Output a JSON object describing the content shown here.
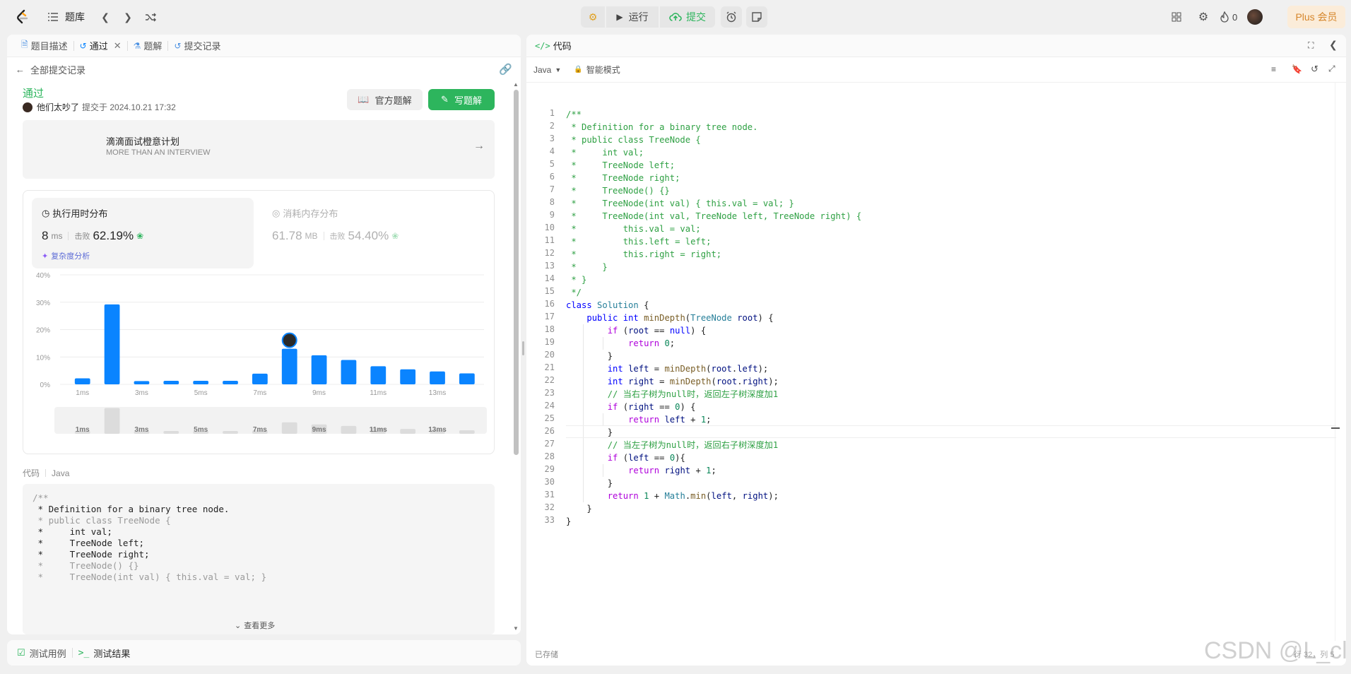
{
  "topbar": {
    "problem_list_label": "题库",
    "run_label": "运行",
    "submit_label": "提交",
    "streak_count": "0",
    "plus_label": "Plus 会员"
  },
  "left": {
    "tabs": [
      {
        "label": "题目描述"
      },
      {
        "label": "通过"
      },
      {
        "label": "题解"
      },
      {
        "label": "提交记录"
      }
    ],
    "back_label": "全部提交记录",
    "status": "通过",
    "user": "他们太吵了",
    "submitted_at": "提交于 2024.10.21 17:32",
    "official_solution_label": "官方题解",
    "write_solution_label": "写题解",
    "promo": {
      "title": "滴滴面试橙意计划",
      "subtitle": "MORE THAN AN INTERVIEW"
    },
    "runtime": {
      "title": "执行用时分布",
      "value": "8",
      "unit": "ms",
      "beats_label": "击败",
      "beats": "62.19%",
      "analysis_label": "复杂度分析"
    },
    "memory": {
      "title": "消耗内存分布",
      "value": "61.78",
      "unit": "MB",
      "beats_label": "击败",
      "beats": "54.40%"
    },
    "code_label": "代码",
    "code_lang": "Java",
    "code_preview": [
      "/**",
      " * Definition for a binary tree node.",
      " * public class TreeNode {",
      " *     int val;",
      " *     TreeNode left;",
      " *     TreeNode right;",
      " *     TreeNode() {}",
      " *     TreeNode(int val) { this.val = val; }"
    ],
    "more_label": "查看更多"
  },
  "bottom_left": {
    "testcase_label": "测试用例",
    "result_label": "测试结果"
  },
  "chart_data": {
    "type": "bar",
    "title": "执行用时分布",
    "categories": [
      "1ms",
      "2ms",
      "3ms",
      "4ms",
      "5ms",
      "6ms",
      "7ms",
      "8ms",
      "9ms",
      "10ms",
      "11ms",
      "12ms",
      "13ms",
      "14ms"
    ],
    "x_tick_labels": [
      "1ms",
      "3ms",
      "5ms",
      "7ms",
      "9ms",
      "11ms",
      "13ms"
    ],
    "y_tick_labels": [
      "40%",
      "30%",
      "20%",
      "10%",
      "0%"
    ],
    "values": [
      2.2,
      29.2,
      1.2,
      1.3,
      1.3,
      1.3,
      3.9,
      13.0,
      10.6,
      8.9,
      6.6,
      5.5,
      4.7,
      4.0
    ],
    "highlight_category": "8ms",
    "ylim": [
      0,
      40
    ],
    "grid": true,
    "color": "#0a84ff"
  },
  "right": {
    "title": "代码",
    "language": "Java",
    "mode": "智能模式",
    "saved_label": "已存储",
    "watermark": "CSDN @L_cl",
    "cursor_status": "行 32，列 5",
    "code_lines": [
      "/**",
      " * Definition for a binary tree node.",
      " * public class TreeNode {",
      " *     int val;",
      " *     TreeNode left;",
      " *     TreeNode right;",
      " *     TreeNode() {}",
      " *     TreeNode(int val) { this.val = val; }",
      " *     TreeNode(int val, TreeNode left, TreeNode right) {",
      " *         this.val = val;",
      " *         this.left = left;",
      " *         this.right = right;",
      " *     }",
      " * }",
      " */",
      "class Solution {",
      "    public int minDepth(TreeNode root) {",
      "        if (root == null) {",
      "            return 0;",
      "        }",
      "        int left = minDepth(root.left);",
      "        int right = minDepth(root.right);",
      "        // 当右子树为null时，返回左子树深度加1",
      "        if (right == 0) {",
      "            return left + 1;",
      "        }",
      "        // 当左子树为null时，返回右子树深度加1",
      "        if (left == 0){",
      "            return right + 1;",
      "        }",
      "        return 1 + Math.min(left, right);",
      "    }",
      "}"
    ]
  }
}
